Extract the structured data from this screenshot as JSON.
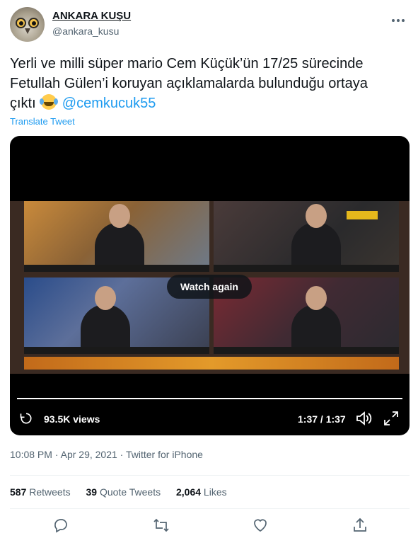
{
  "author": {
    "name": "ANKARA KUŞU",
    "handle": "@ankara_kusu"
  },
  "tweet": {
    "text_part1": "Yerli ve milli süper mario Cem Küçük’ün 17/25 sürecinde Fetullah Gülen’i koruyan açıklamalarda bulunduğu ortaya çıktı",
    "emoji": "face-with-tears-of-joy",
    "mention": "@cemkucuk55",
    "translate_label": "Translate Tweet"
  },
  "video": {
    "overlay_label": "Watch again",
    "views": "93.5K views",
    "time": "1:37 / 1:37",
    "progress_percent": 100
  },
  "meta": {
    "time": "10:08 PM",
    "sep1": " · ",
    "date": "Apr 29, 2021",
    "sep2": " · ",
    "source": "Twitter for iPhone"
  },
  "stats": {
    "retweets_count": "587",
    "retweets_label": " Retweets",
    "quotes_count": "39",
    "quotes_label": " Quote Tweets",
    "likes_count": "2,064",
    "likes_label": " Likes"
  },
  "icons": [
    "more-icon",
    "replay-icon",
    "volume-icon",
    "fullscreen-icon",
    "reply-icon",
    "retweet-icon",
    "like-icon",
    "share-icon"
  ],
  "colors": {
    "accent": "#1d9bf0",
    "secondary_text": "#536471",
    "primary_text": "#0f1419"
  }
}
